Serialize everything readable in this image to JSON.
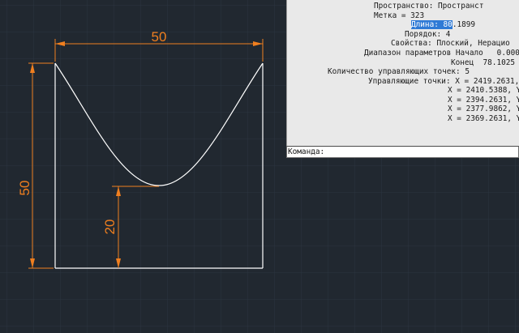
{
  "drawing": {
    "dim_top": "50",
    "dim_left": "50",
    "dim_inner": "20",
    "dim_color": "#f07f1f",
    "geometry_color": "#ffffff",
    "background_color": "#212830"
  },
  "list_output": {
    "line1": "Пространство: Пространст",
    "line2": "Метка = 323",
    "line3_prefix": "Длина: 80",
    "line3_suffix": ".1899",
    "line4": "Порядок: 4",
    "line5": "Свойства: Плоский, Нерацио",
    "line6": "Диапазон параметров Начало   0.000",
    "line7": "Конец  78.1025",
    "line8": "Количество управляющих точек: 5",
    "line9": "Управляющие точки: X = 2419.2631,",
    "line10": "X = 2410.5388, Y",
    "line11": "X = 2394.2631, Y",
    "line12": "X = 2377.9862, Y",
    "line13": "X = 2369.2631, Y"
  },
  "command_line": {
    "prompt": "Команда:"
  }
}
